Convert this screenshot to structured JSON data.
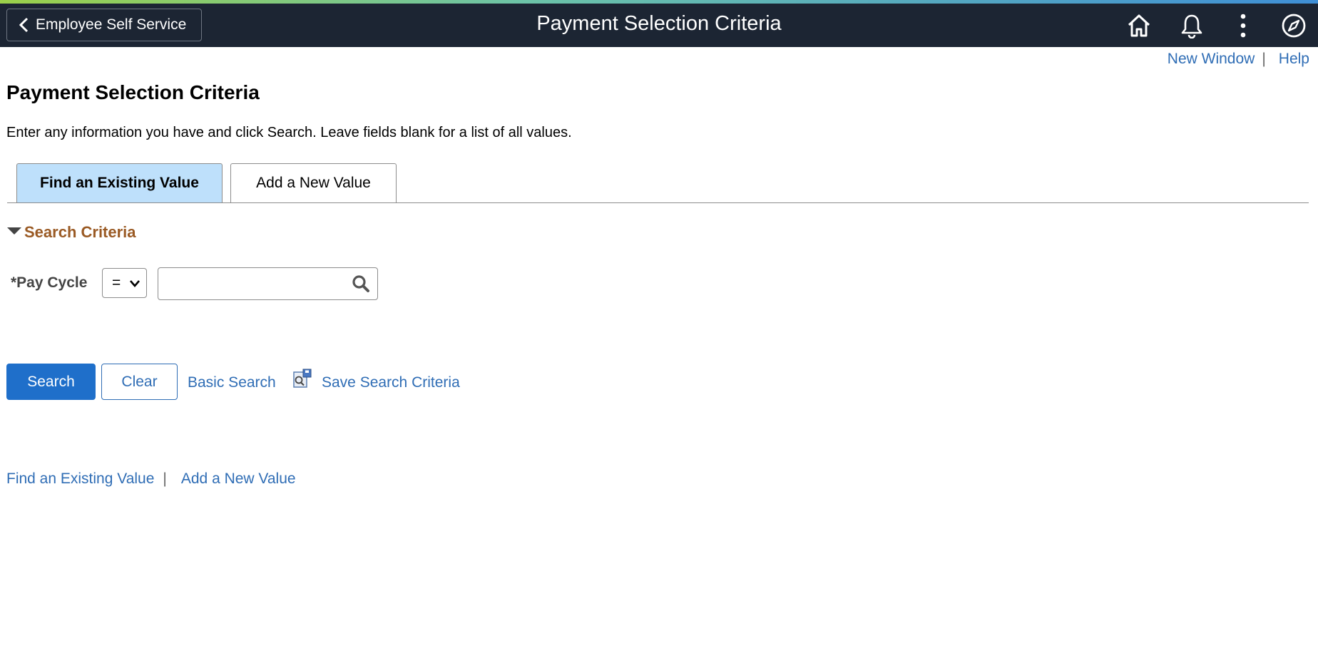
{
  "header": {
    "back_label": "Employee Self Service",
    "title": "Payment Selection Criteria",
    "icons": [
      "home-icon",
      "bell-icon",
      "more-vertical-icon",
      "compass-icon"
    ]
  },
  "utility_links": {
    "new_window": "New Window",
    "separator": "|",
    "help": "Help"
  },
  "page": {
    "title": "Payment Selection Criteria",
    "instructions": "Enter any information you have and click Search. Leave fields blank for a list of all values."
  },
  "tabs": [
    {
      "label": "Find an Existing Value",
      "active": true
    },
    {
      "label": "Add a New Value",
      "active": false
    }
  ],
  "search_criteria": {
    "heading": "Search Criteria",
    "field_label": "*Pay Cycle",
    "operator": "=",
    "value": ""
  },
  "actions": {
    "search": "Search",
    "clear": "Clear",
    "basic_search": "Basic Search",
    "save_search": "Save Search Criteria"
  },
  "footer_links": {
    "find": "Find an Existing Value",
    "separator": "|",
    "add": "Add a New Value"
  },
  "colors": {
    "header_bg": "#1c2533",
    "link": "#2f6db5",
    "section_heading": "#9a5a24",
    "active_tab": "#bee0fb",
    "primary_button": "#1f6fca"
  }
}
